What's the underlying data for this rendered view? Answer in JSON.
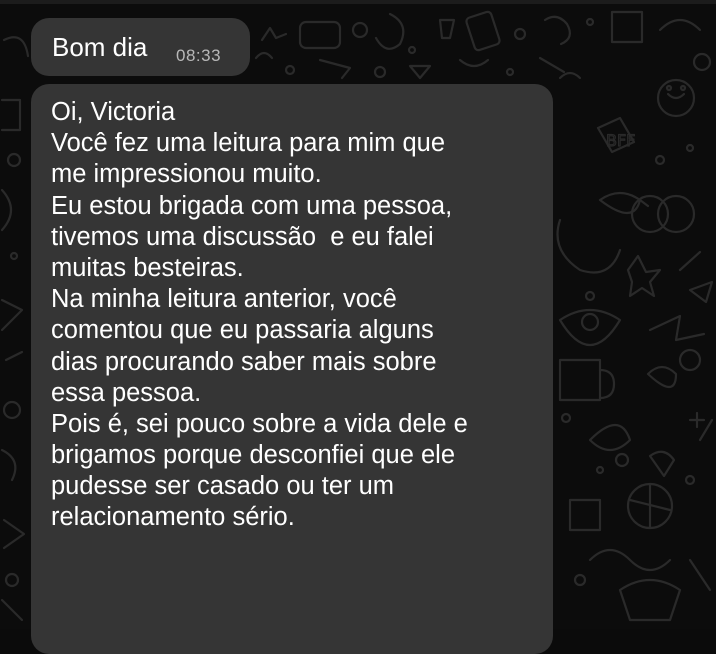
{
  "colors": {
    "bubble": "#353535",
    "text": "#ffffff",
    "time": "#b8b8b8",
    "wallpaper": "#0c0c0c",
    "doodle": "#2a2a2a"
  },
  "messages": [
    {
      "text": "Bom dia",
      "time": "08:33"
    },
    {
      "lines": [
        "Oi, Victoria",
        "Você fez uma leitura para mim que",
        "me impressionou muito.",
        "Eu estou brigada com uma pessoa,",
        "tivemos uma discussão  e eu falei",
        "muitas besteiras.",
        "Na minha leitura anterior, você",
        "comentou que eu passaria alguns",
        "dias procurando saber mais sobre",
        "essa pessoa.",
        "Pois é, sei pouco sobre a vida dele e",
        "brigamos porque desconfiei que ele",
        "pudesse ser casado ou ter um",
        "relacionamento sério."
      ]
    }
  ]
}
